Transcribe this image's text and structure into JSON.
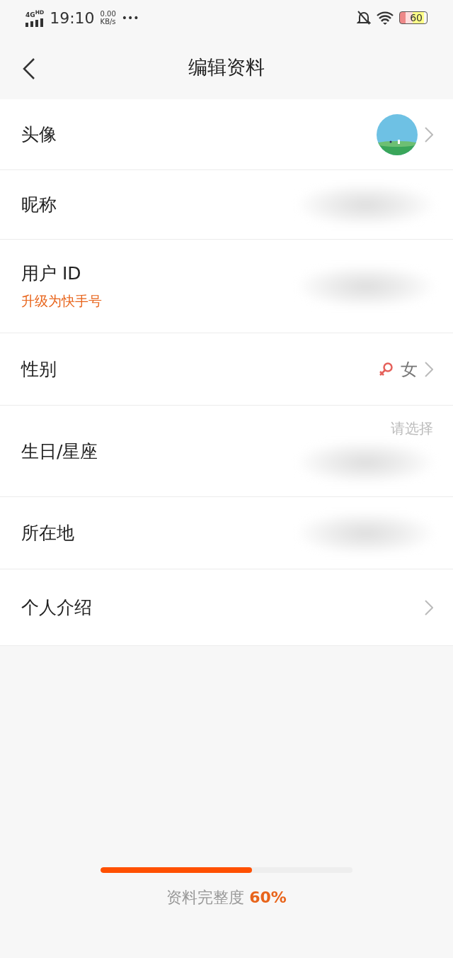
{
  "status_bar": {
    "network": "4G",
    "network_badge": "HD",
    "time": "19:10",
    "speed": "0.00",
    "speed_unit": "KB/s",
    "more": "•••",
    "battery": "60"
  },
  "nav": {
    "title": "编辑资料"
  },
  "rows": [
    {
      "kind": "avatar",
      "label": "头像",
      "chevron": true
    },
    {
      "kind": "blurred",
      "label": "昵称",
      "chevron": false
    },
    {
      "kind": "blurred",
      "label": "用户 ID",
      "sublabel": "升级为快手号",
      "chevron": false
    },
    {
      "kind": "gender",
      "label": "性别",
      "value": "女",
      "chevron": true
    },
    {
      "kind": "hint",
      "label": "生日/星座",
      "hint": "请选择",
      "chevron": false
    },
    {
      "kind": "blurred",
      "label": "所在地",
      "chevron": false
    },
    {
      "kind": "plain",
      "label": "个人介绍",
      "chevron": true
    }
  ],
  "completeness": {
    "label": "资料完整度",
    "value": "60%",
    "level": 0.6
  }
}
